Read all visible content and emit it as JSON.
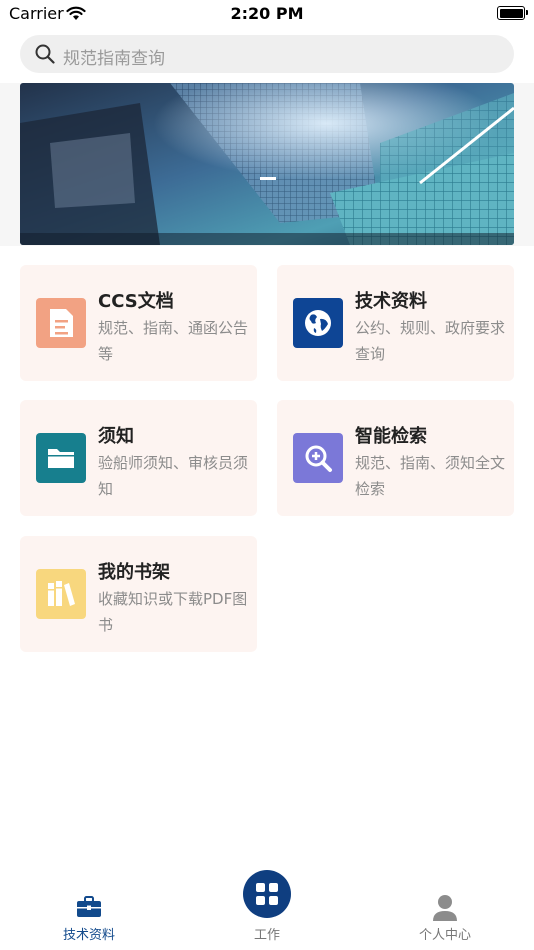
{
  "status_bar": {
    "carrier": "Carrier",
    "time": "2:20 PM"
  },
  "search": {
    "placeholder": "规范指南查询"
  },
  "cards": [
    {
      "title": "CCS文档",
      "desc": "规范、指南、通函公告等",
      "icon": "document-icon",
      "color": "#f2a283"
    },
    {
      "title": "技术资料",
      "desc": "公约、规则、政府要求查询",
      "icon": "globe-icon",
      "color": "#0e4595"
    },
    {
      "title": "须知",
      "desc": "验船师须知、审核员须知",
      "icon": "folder-icon",
      "color": "#177f8e"
    },
    {
      "title": "智能检索",
      "desc": "规范、指南、须知全文检索",
      "icon": "magnifier-plus-icon",
      "color": "#7b78d8"
    },
    {
      "title": "我的书架",
      "desc": "收藏知识或下载PDF图书",
      "icon": "bookshelf-icon",
      "color": "#f8d77e"
    }
  ],
  "tabbar": {
    "items": [
      {
        "label": "技术资料",
        "icon": "toolbox-icon",
        "active": true
      },
      {
        "label": "工作",
        "icon": "grid-icon",
        "active": false
      },
      {
        "label": "个人中心",
        "icon": "person-icon",
        "active": false
      }
    ],
    "active_color": "#124a8c"
  }
}
